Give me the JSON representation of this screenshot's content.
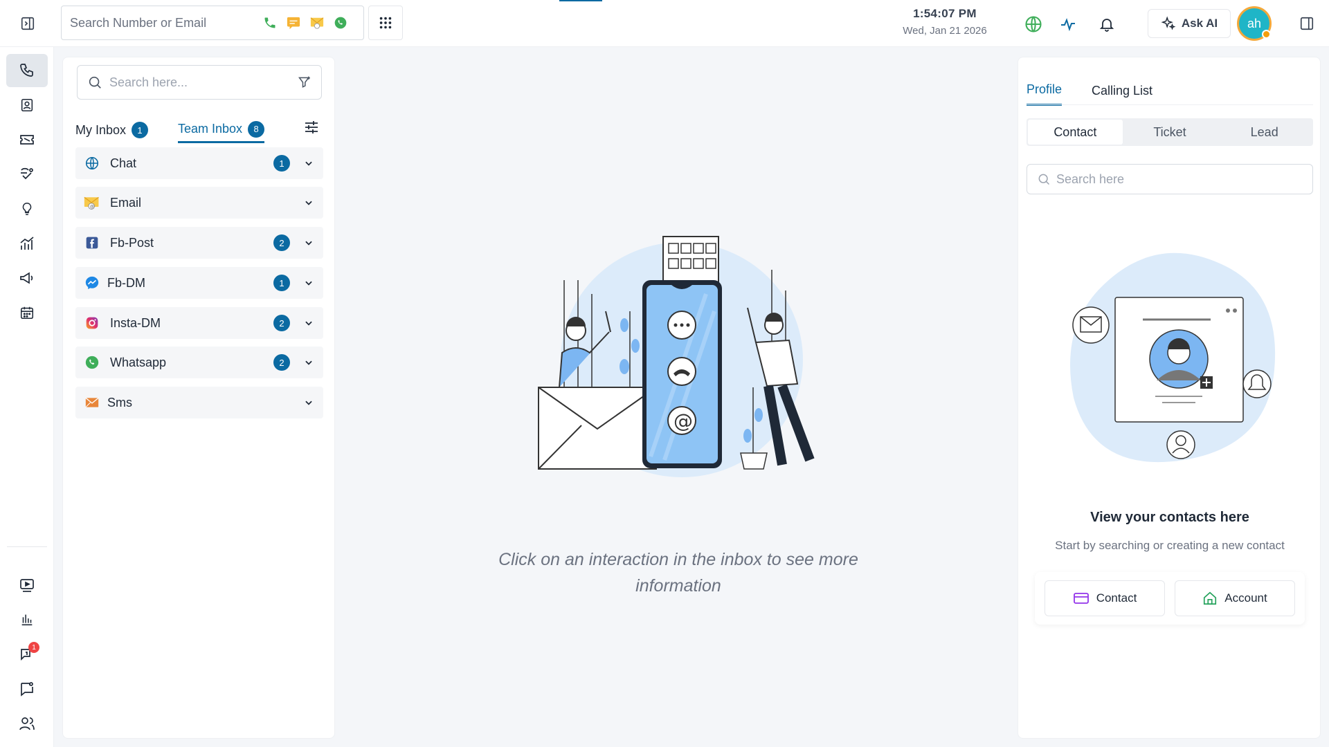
{
  "header": {
    "search_placeholder": "Search Number or Email",
    "time": "1:54:07 PM",
    "date": "Wed, Jan 21 2026",
    "ask_ai_label": "Ask AI",
    "avatar_initials": "ah",
    "colors": {
      "brand": "#0b6aa2",
      "avatar_bg": "#1fb5c7",
      "avatar_ring": "#f4a83a"
    }
  },
  "rail": {
    "items": [
      {
        "icon": "phone-icon"
      },
      {
        "icon": "contacts-book-icon"
      },
      {
        "icon": "ticket-icon"
      },
      {
        "icon": "funnel-leads-icon"
      },
      {
        "icon": "lightbulb-icon"
      },
      {
        "icon": "analytics-icon"
      },
      {
        "icon": "megaphone-icon"
      },
      {
        "icon": "calendar-icon"
      },
      {
        "icon": "video-tutorial-icon"
      },
      {
        "icon": "bar-chart-icon"
      },
      {
        "icon": "notification-icon",
        "badge": "1"
      },
      {
        "icon": "chat-settings-icon"
      },
      {
        "icon": "users-icon"
      }
    ]
  },
  "inbox": {
    "search_placeholder": "Search here...",
    "tabs": [
      {
        "label": "My Inbox",
        "count": "1"
      },
      {
        "label": "Team Inbox",
        "count": "8"
      }
    ],
    "channels": [
      {
        "label": "Chat",
        "count": "1",
        "icon": "globe-icon"
      },
      {
        "label": "Email",
        "count": "",
        "icon": "email-icon"
      },
      {
        "label": "Fb-Post",
        "count": "2",
        "icon": "facebook-icon"
      },
      {
        "label": "Fb-DM",
        "count": "1",
        "icon": "messenger-icon"
      },
      {
        "label": "Insta-DM",
        "count": "2",
        "icon": "instagram-icon"
      },
      {
        "label": "Whatsapp",
        "count": "2",
        "icon": "whatsapp-icon"
      },
      {
        "label": "Sms",
        "count": "",
        "icon": "sms-envelope-icon"
      }
    ]
  },
  "center": {
    "message": "Click on an interaction in the inbox to see more information"
  },
  "profile": {
    "tabs": [
      "Profile",
      "Calling List"
    ],
    "segments": [
      "Contact",
      "Ticket",
      "Lead"
    ],
    "search_placeholder": "Search here",
    "title": "View your contacts here",
    "subtitle": "Start by searching or creating a new contact",
    "actions": [
      {
        "label": "Contact",
        "icon": "contact-card-icon"
      },
      {
        "label": "Account",
        "icon": "account-home-icon"
      }
    ]
  }
}
